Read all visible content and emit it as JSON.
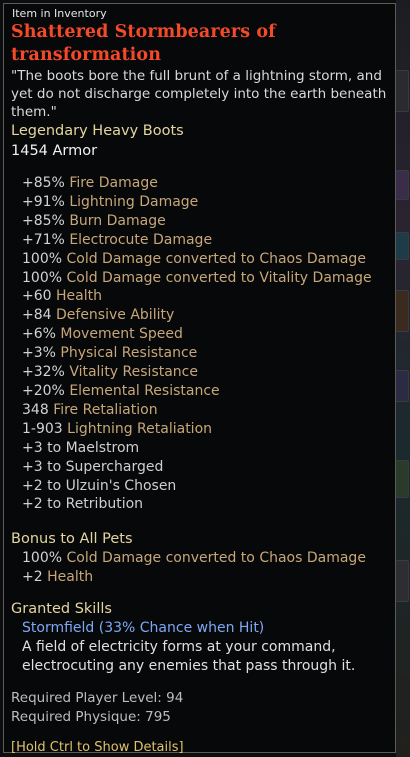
{
  "header": {
    "tag": "Item in Inventory"
  },
  "item": {
    "name": "Shattered Stormbearers of transformation",
    "flavor": "\"The boots bore the full brunt of a lightning storm, and yet do not discharge completely into the earth beneath them.\"",
    "type": "Legendary Heavy Boots",
    "armor": "1454 Armor",
    "name_color": "#f44a2a"
  },
  "stats": [
    {
      "num": "+85%",
      "label": "Fire Damage"
    },
    {
      "num": "+91%",
      "label": "Lightning Damage"
    },
    {
      "num": "+85%",
      "label": "Burn Damage"
    },
    {
      "num": "+71%",
      "label": "Electrocute Damage"
    },
    {
      "num": "100%",
      "label": "Cold Damage converted to Chaos Damage"
    },
    {
      "num": "100%",
      "label": "Cold Damage converted to Vitality Damage"
    },
    {
      "num": "+60",
      "label": "Health"
    },
    {
      "num": "+84",
      "label": "Defensive Ability"
    },
    {
      "num": "+6%",
      "label": "Movement Speed"
    },
    {
      "num": "+3%",
      "label": "Physical Resistance"
    },
    {
      "num": "+32%",
      "label": "Vitality Resistance"
    },
    {
      "num": "+20%",
      "label": "Elemental Resistance"
    },
    {
      "num": "348",
      "label": "Fire Retaliation"
    },
    {
      "num": "1-903",
      "label": "Lightning Retaliation"
    }
  ],
  "skill_bonuses": [
    "+3 to Maelstrom",
    "+3 to Supercharged",
    "+2 to Ulzuin's Chosen",
    "+2 to Retribution"
  ],
  "pets": {
    "title": "Bonus to All Pets",
    "stats": [
      {
        "num": "100%",
        "label": "Cold Damage converted to Chaos Damage"
      },
      {
        "num": "+2",
        "label": "Health"
      }
    ]
  },
  "granted": {
    "title": "Granted Skills",
    "skill": "Stormfield (33% Chance when Hit)",
    "description": "A field of electricity forms at your command, electrocuting any enemies that pass through it."
  },
  "requirements": {
    "level_label": "Required Player Level:",
    "level": "94",
    "physique_label": "Required Physique:",
    "physique": "795"
  },
  "hint": "[Hold Ctrl to Show Details]"
}
